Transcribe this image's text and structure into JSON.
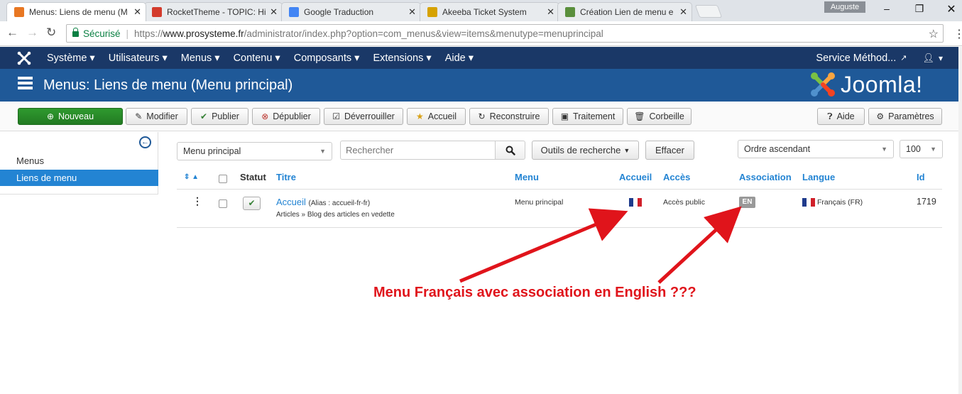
{
  "browser": {
    "tabs": [
      {
        "label": "Menus: Liens de menu (M",
        "fav": "#e87722",
        "close": "✕"
      },
      {
        "label": "RocketTheme - TOPIC: Hi",
        "fav": "#d33b2c",
        "close": "✕"
      },
      {
        "label": "Google Traduction",
        "fav": "#4285f4",
        "close": "✕"
      },
      {
        "label": "Akeeba Ticket System",
        "fav": "#d6a200",
        "close": "✕"
      },
      {
        "label": "Création Lien de menu e",
        "fav": "#5a8f3c",
        "close": "✕"
      }
    ],
    "profile": "Auguste",
    "secure_label": "Sécurisé",
    "url_scheme": "https://",
    "url_host": "www.prosysteme.fr",
    "url_path": "/administrator/index.php?option=com_menus&view=items&menutype=menuprincipal"
  },
  "topnav": {
    "items": [
      "Système ▾",
      "Utilisateurs ▾",
      "Menus ▾",
      "Contenu ▾",
      "Composants ▾",
      "Extensions ▾",
      "Aide ▾"
    ],
    "site_link": "Service Méthod...",
    "user": "▾"
  },
  "header": {
    "title": "Menus: Liens de menu (Menu principal)",
    "brand": "Joomla!"
  },
  "toolbar": {
    "new": "Nouveau",
    "edit": "Modifier",
    "publish": "Publier",
    "unpublish": "Dépublier",
    "checkin": "Déverrouiller",
    "home": "Accueil",
    "rebuild": "Reconstruire",
    "batch": "Traitement",
    "trash": "Corbeille",
    "help": "Aide",
    "options": "Paramètres"
  },
  "sidebar": {
    "items": [
      "Menus",
      "Liens de menu"
    ]
  },
  "filters": {
    "menu_select": "Menu principal",
    "search_placeholder": "Rechercher",
    "search_tools": "Outils de recherche",
    "clear": "Effacer",
    "ordering": "Ordre ascendant",
    "limit": "100"
  },
  "table": {
    "columns": [
      "Statut",
      "Titre",
      "Menu",
      "Accueil",
      "Accès",
      "Association",
      "Langue",
      "Id"
    ],
    "rows": [
      {
        "title": "Accueil",
        "alias": "(Alias : accueil-fr-fr)",
        "subtitle": "Articles » Blog des articles en vedette",
        "menu": "Menu principal",
        "access": "Accès public",
        "association": "EN",
        "language": "Français (FR)",
        "id": "1719"
      }
    ]
  },
  "annotation": {
    "text": "Menu Français avec association en English ???",
    "color": "#e0141b"
  },
  "colors": {
    "topnav": "#1a3867",
    "header": "#1f5998",
    "accent": "#2384d3",
    "new_button": "#2f9a2f"
  }
}
